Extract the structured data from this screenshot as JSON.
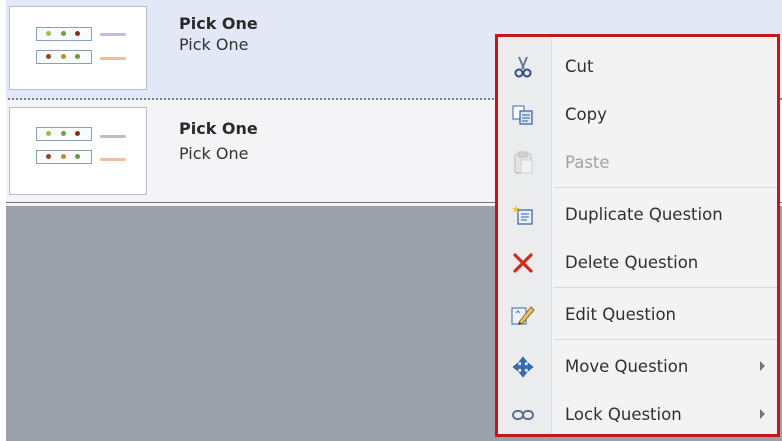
{
  "questions": [
    {
      "title": "Pick One",
      "subtitle": "Pick One"
    },
    {
      "title": "Pick One",
      "subtitle": "Pick One"
    }
  ],
  "context_menu": {
    "items": [
      {
        "label": "Cut",
        "icon": "scissors-icon",
        "disabled": false
      },
      {
        "label": "Copy",
        "icon": "copy-icon",
        "disabled": false
      },
      {
        "label": "Paste",
        "icon": "paste-icon",
        "disabled": true
      },
      {
        "label": "Duplicate Question",
        "icon": "duplicate-icon",
        "disabled": false
      },
      {
        "label": "Delete Question",
        "icon": "delete-icon",
        "disabled": false
      },
      {
        "label": "Edit Question",
        "icon": "edit-icon",
        "disabled": false
      },
      {
        "label": "Move Question",
        "icon": "move-icon",
        "disabled": false,
        "submenu": true
      },
      {
        "label": "Lock Question",
        "icon": "lock-link-icon",
        "disabled": false,
        "submenu": true
      }
    ]
  },
  "colors": {
    "selected_row": "#e2e8f5",
    "menu_border": "#c11820",
    "background": "#9aa1ab"
  }
}
